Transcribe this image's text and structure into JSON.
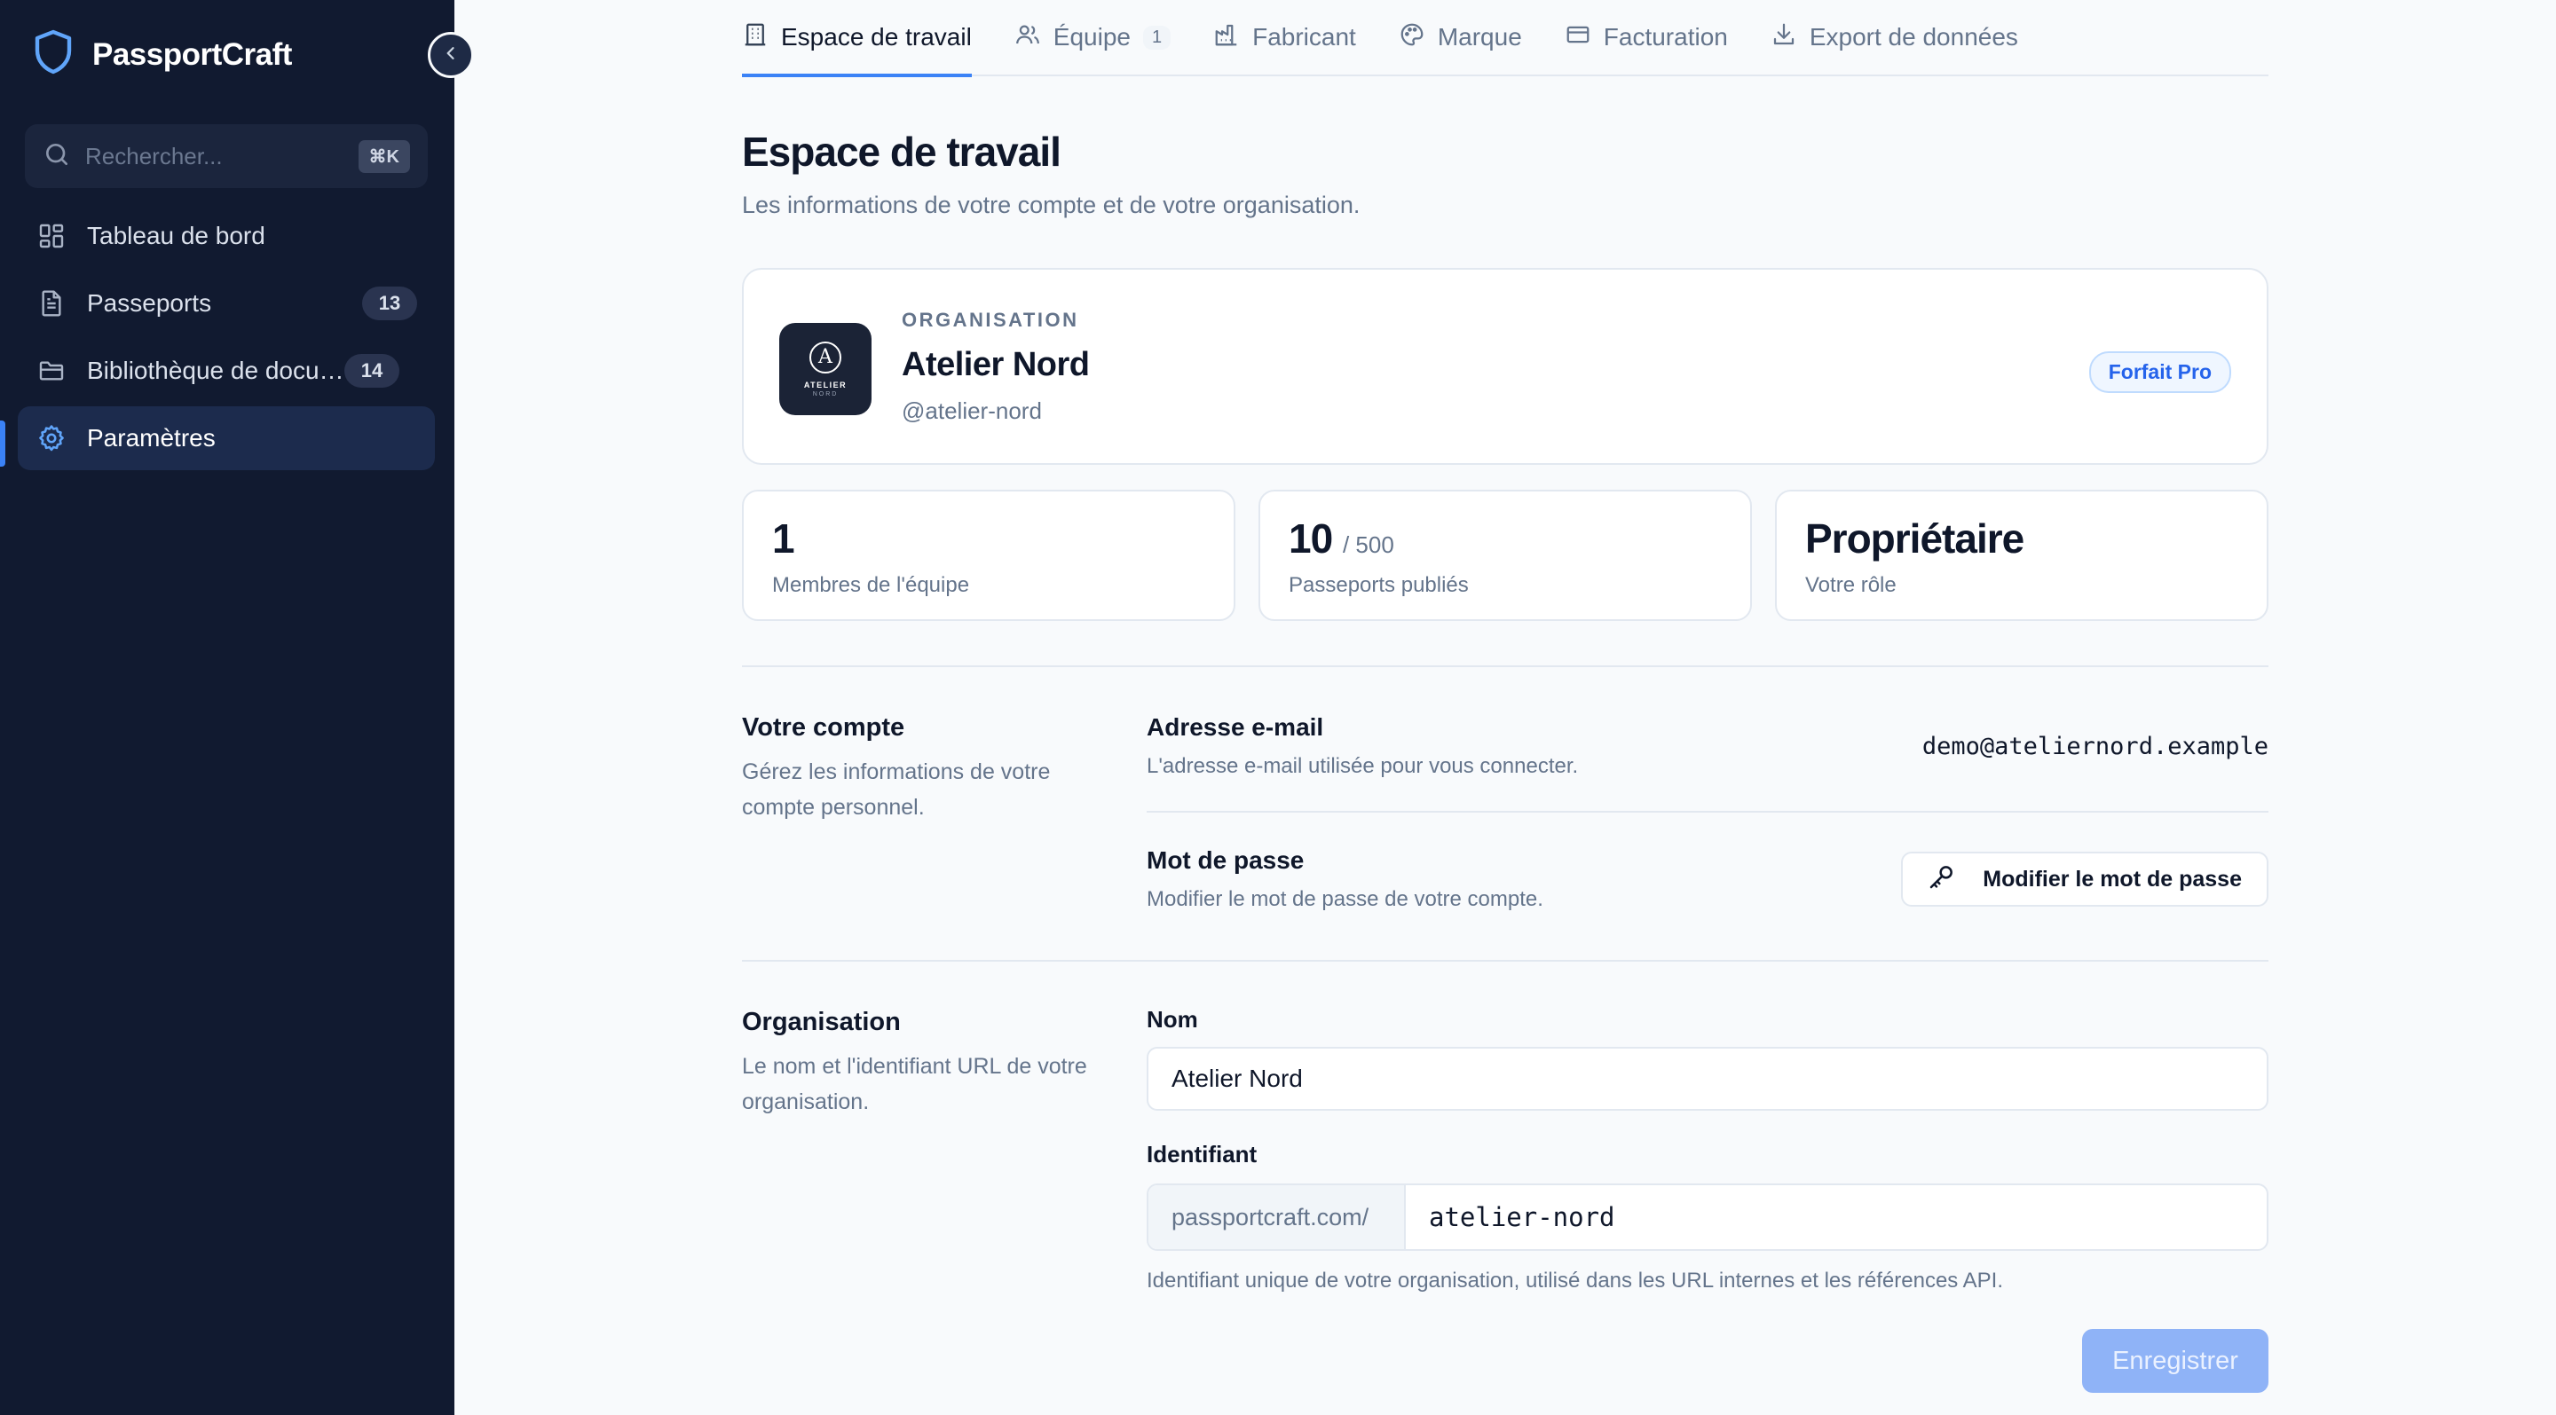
{
  "app": {
    "name": "PassportCraft"
  },
  "sidebar": {
    "search_placeholder": "Rechercher...",
    "search_shortcut": "⌘K",
    "items": [
      {
        "label": "Tableau de bord",
        "icon": "grid-icon",
        "count": ""
      },
      {
        "label": "Passeports",
        "icon": "file-icon",
        "count": "13"
      },
      {
        "label": "Bibliothèque de documents",
        "icon": "folder-icon",
        "count": "14"
      },
      {
        "label": "Paramètres",
        "icon": "gear-icon",
        "count": "",
        "active": true
      }
    ]
  },
  "tabs": [
    {
      "label": "Espace de travail",
      "icon": "building-icon",
      "active": true
    },
    {
      "label": "Équipe",
      "icon": "users-icon",
      "badge": "1"
    },
    {
      "label": "Fabricant",
      "icon": "factory-icon"
    },
    {
      "label": "Marque",
      "icon": "palette-icon"
    },
    {
      "label": "Facturation",
      "icon": "credit-card-icon"
    },
    {
      "label": "Export de données",
      "icon": "download-icon"
    }
  ],
  "page": {
    "title": "Espace de travail",
    "subtitle": "Les informations de votre compte et de votre organisation."
  },
  "org_card": {
    "kicker": "ORGANISATION",
    "name": "Atelier Nord",
    "handle": "@atelier-nord",
    "plan": "Forfait Pro",
    "logo_letter": "A",
    "logo_line1": "ATELIER",
    "logo_line2": "NORD"
  },
  "stats": [
    {
      "value": "1",
      "suffix": "",
      "label": "Membres de l'équipe"
    },
    {
      "value": "10",
      "suffix": "/ 500",
      "label": "Passeports publiés"
    },
    {
      "value": "Propriétaire",
      "suffix": "",
      "label": "Votre rôle"
    }
  ],
  "account": {
    "title": "Votre compte",
    "desc": "Gérez les informations de votre compte personnel.",
    "email_label": "Adresse e-mail",
    "email_desc": "L'adresse e-mail utilisée pour vous connecter.",
    "email_value": "demo@ateliernord.example",
    "password_label": "Mot de passe",
    "password_desc": "Modifier le mot de passe de votre compte.",
    "password_button": "Modifier le mot de passe"
  },
  "organization": {
    "title": "Organisation",
    "desc": "Le nom et l'identifiant URL de votre organisation.",
    "name_label": "Nom",
    "name_value": "Atelier Nord",
    "slug_label": "Identifiant",
    "slug_prefix": "passportcraft.com/",
    "slug_value": "atelier-nord",
    "slug_hint": "Identifiant unique de votre organisation, utilisé dans les URL internes et les références API.",
    "save_button": "Enregistrer"
  },
  "colors": {
    "sidebar_bg": "#111a30",
    "accent": "#3b82f6",
    "page_bg": "#f8fafc"
  }
}
